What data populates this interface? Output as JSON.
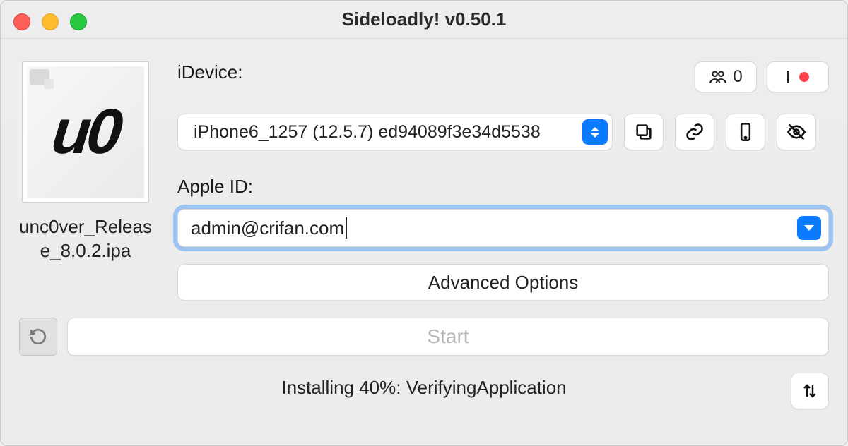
{
  "window": {
    "title": "Sideloadly! v0.50.1"
  },
  "ipa": {
    "filename": "unc0ver_Release_8.0.2.ipa",
    "logo_text": "u0"
  },
  "labels": {
    "idevice": "iDevice:",
    "appleid": "Apple ID:"
  },
  "header_buttons": {
    "queue_count": "0"
  },
  "device_dropdown": {
    "selected": "iPhone6_1257 (12.5.7) ed94089f3e34d5538"
  },
  "apple_id": {
    "value": "admin@crifan.com"
  },
  "buttons": {
    "advanced": "Advanced Options",
    "start": "Start"
  },
  "status": {
    "text": "Installing 40%: VerifyingApplication"
  }
}
